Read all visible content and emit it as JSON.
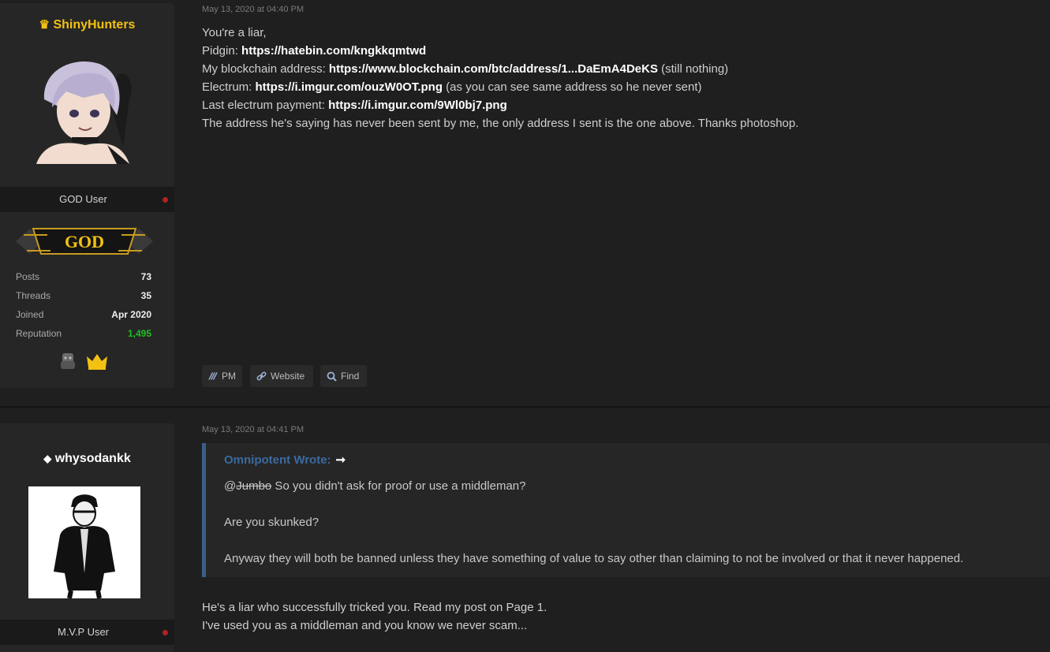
{
  "post1": {
    "username": "ShinyHunters",
    "rank_title": "GOD User",
    "rank_badge_text": "GOD",
    "stats": [
      {
        "label": "Posts",
        "value": "73"
      },
      {
        "label": "Threads",
        "value": "35"
      },
      {
        "label": "Joined",
        "value": "Apr 2020"
      },
      {
        "label": "Reputation",
        "value": "1,495"
      }
    ],
    "date": "May 13, 2020 at 04:40 PM",
    "lines": {
      "l1": "You're a liar,",
      "l2_label": "Pidgin: ",
      "l2_link": "https://hatebin.com/kngkkqmtwd",
      "l3_label": "My blockchain address: ",
      "l3_link": "https://www.blockchain.com/btc/address/1...DaEmA4DeKS",
      "l3_suffix": " (still nothing)",
      "l4_label": "Electrum: ",
      "l4_link": "https://i.imgur.com/ouzW0OT.png",
      "l4_suffix": " (as you can see same address so he never sent)",
      "l5_label": "Last electrum payment: ",
      "l5_link": "https://i.imgur.com/9Wl0bj7.png",
      "l6": "The address he's saying has never been sent by me, the only address I sent is the one above. Thanks photoshop."
    },
    "buttons": {
      "pm": "PM",
      "website": "Website",
      "find": "Find"
    }
  },
  "post2": {
    "username": "whysodankk",
    "rank_title": "M.V.P User",
    "date": "May 13, 2020 at 04:41 PM",
    "quote": {
      "author": "Omnipotent Wrote:",
      "arrow": "➞",
      "mention_at": "@",
      "mention_name": "Jumbo",
      "line1_rest": " So you didn't ask for proof or use a middleman?",
      "line2": "Are you skunked?",
      "line3": "Anyway they will both be banned unless they have something of value to say other than claiming to not be involved or that it never happened."
    },
    "body": {
      "line1": "He's a liar who successfully tricked you. Read my post on Page 1.",
      "line2": "I've used you as a middleman and you know we never scam..."
    }
  },
  "colors": {
    "background": "#1f1f1f",
    "gold": "#f3c112",
    "reputation_green": "#1fbf1f",
    "quote_blue": "#3b6aa0"
  }
}
